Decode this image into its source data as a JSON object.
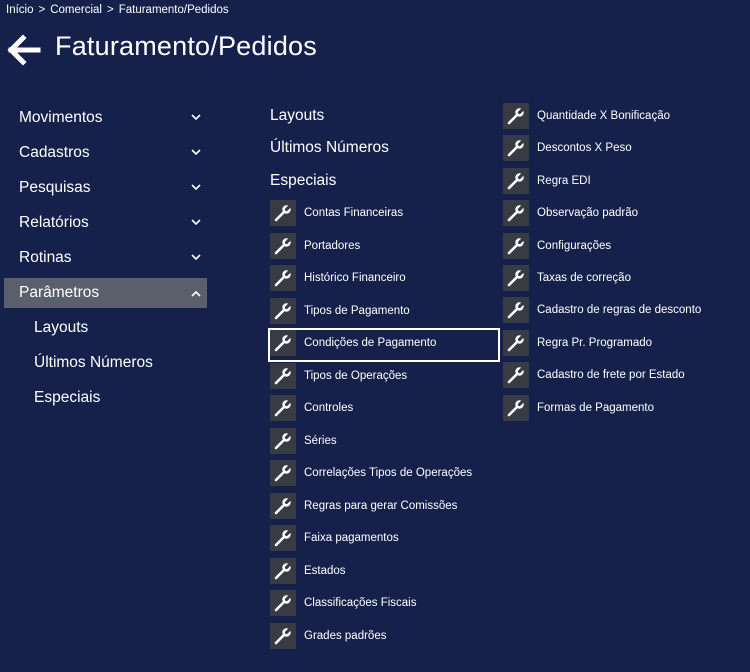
{
  "breadcrumb": {
    "items": [
      "Início",
      "Comercial",
      "Faturamento/Pedidos"
    ],
    "separator": ">"
  },
  "header": {
    "title": "Faturamento/Pedidos",
    "back_icon": "arrow-left-icon"
  },
  "sidebar": {
    "items": [
      {
        "label": "Movimentos",
        "chevron": "chevron-down-icon"
      },
      {
        "label": "Cadastros",
        "chevron": "chevron-down-icon"
      },
      {
        "label": "Pesquisas",
        "chevron": "chevron-down-icon"
      },
      {
        "label": "Relatórios",
        "chevron": "chevron-down-icon"
      },
      {
        "label": "Rotinas",
        "chevron": "chevron-down-icon"
      },
      {
        "label": "Parâmetros",
        "chevron": "chevron-up-icon",
        "active": true
      }
    ],
    "subitems": [
      "Layouts",
      "Últimos Números",
      "Especiais"
    ]
  },
  "sections": {
    "layouts": "Layouts",
    "ultimos": "Últimos Números",
    "especiais": "Especiais"
  },
  "tools_left": [
    "Contas Financeiras",
    "Portadores",
    "Histórico Financeiro",
    "Tipos de Pagamento",
    "Condições de Pagamento",
    "Tipos de Operações",
    "Controles",
    "Séries",
    "Correlações Tipos de Operações",
    "Regras para gerar Comissões",
    "Faixa pagamentos",
    "Estados",
    "Classificações Fiscais",
    "Grades padrões"
  ],
  "tools_right": [
    "Quantidade X Bonificação",
    "Descontos X Peso",
    "Regra EDI",
    "Observação padrão",
    "Configurações",
    "Taxas de correção",
    "Cadastro de regras de desconto",
    "Regra Pr. Programado",
    "Cadastro de frete por Estado",
    "Formas de Pagamento"
  ],
  "selected_tool": "Condições de Pagamento",
  "tool_icon": "wrench-icon",
  "colors": {
    "background": "#15214b",
    "active_nav": "#5a5f6c",
    "tool_icon_bg": "#373b44",
    "text": "#ffffff"
  }
}
